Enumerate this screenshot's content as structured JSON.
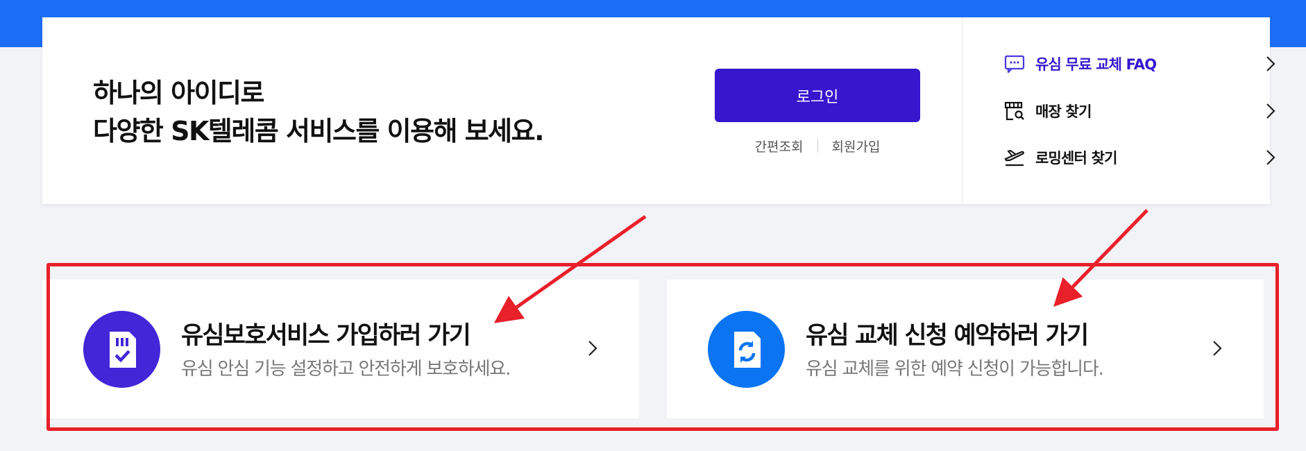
{
  "header": {
    "headline_line1": "하나의 아이디로",
    "headline_line2": "다양한 SK텔레콤 서비스를 이용해 보세요.",
    "login_label": "로그인",
    "quick_lookup_label": "간편조회",
    "signup_label": "회원가입"
  },
  "side_links": [
    {
      "label": "유심 무료 교체 FAQ",
      "icon": "faq-chat-icon"
    },
    {
      "label": "매장 찾기",
      "icon": "store-search-icon"
    },
    {
      "label": "로밍센터 찾기",
      "icon": "airplane-icon"
    }
  ],
  "services": [
    {
      "title": "유심보호서비스 가입하러 가기",
      "desc": "유심 안심 기능 설정하고 안전하게 보호하세요.",
      "icon": "usim-check-icon"
    },
    {
      "title": "유심 교체 신청 예약하러 가기",
      "desc": "유심 교체를 위한 예약 신청이 가능합니다.",
      "icon": "usim-refresh-icon"
    }
  ],
  "colors": {
    "brand_blue": "#1b6ef5",
    "login_purple": "#3617ce",
    "service1_icon_bg": "#4326d8",
    "service2_icon_bg": "#0a74f3",
    "annotation_red": "#e8202a",
    "page_bg": "#f2f3f6"
  }
}
